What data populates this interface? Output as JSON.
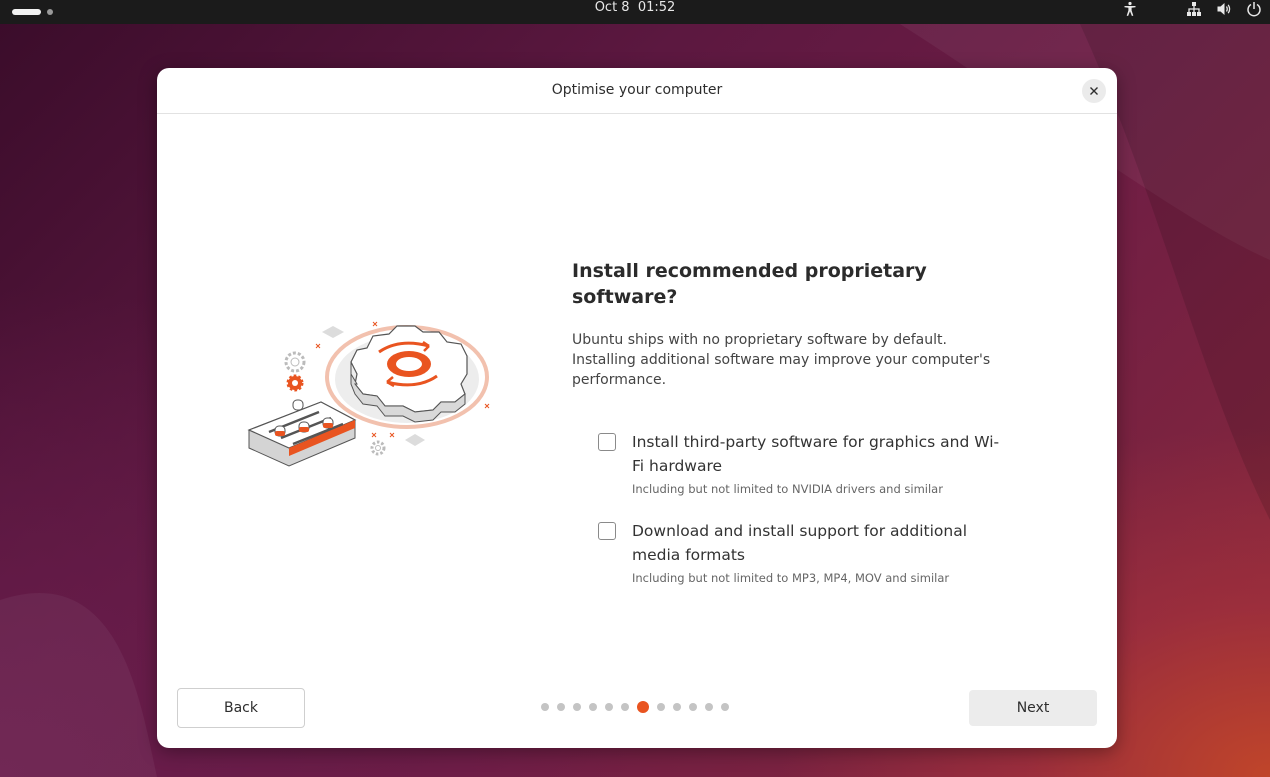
{
  "topbar": {
    "date": "Oct 8",
    "time": "01:52",
    "icons": [
      "accessibility-icon",
      "network-icon",
      "volume-icon",
      "power-icon"
    ]
  },
  "dialog": {
    "title": "Optimise your computer",
    "heading": "Install recommended proprietary software?",
    "description": "Ubuntu ships with no proprietary software by default. Installing additional software may improve your computer's performance.",
    "options": [
      {
        "label": "Install third-party software for graphics and Wi-Fi hardware",
        "hint": "Including but not limited to NVIDIA drivers and similar",
        "checked": false
      },
      {
        "label": "Download and install support for additional media formats",
        "hint": "Including but not limited to MP3, MP4, MOV and similar",
        "checked": false
      }
    ],
    "back_label": "Back",
    "next_label": "Next",
    "pager": {
      "total": 12,
      "current": 7
    }
  },
  "colors": {
    "accent": "#e95420",
    "topbar": "#1b1b1b"
  }
}
